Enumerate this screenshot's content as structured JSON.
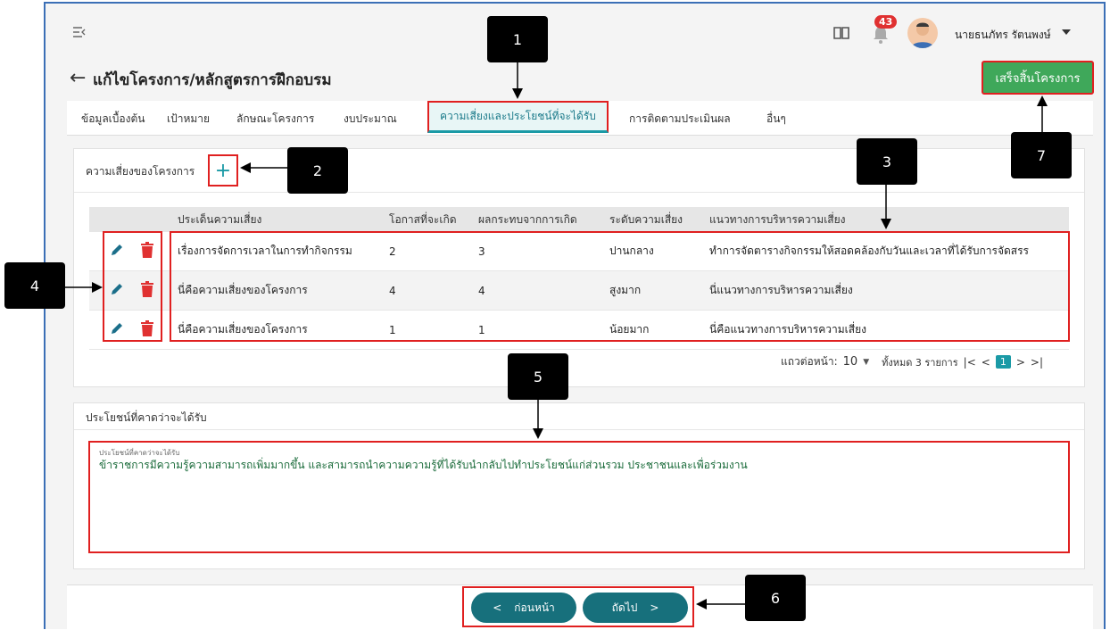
{
  "header": {
    "notification_count": "43",
    "username": "นายธนภัทร รัตนพงษ์",
    "page_title": "แก้ไขโครงการ/หลักสูตรการฝึกอบรม",
    "finish_label": "เสร็จสิ้นโครงการ"
  },
  "tabs": [
    {
      "label": "ข้อมูลเบื้องต้น"
    },
    {
      "label": "เป้าหมาย"
    },
    {
      "label": "ลักษณะโครงการ"
    },
    {
      "label": "งบประมาณ"
    },
    {
      "label": "ความเสี่ยงและประโยชน์ที่จะได้รับ"
    },
    {
      "label": "การติดตามประเมินผล"
    },
    {
      "label": "อื่นๆ"
    }
  ],
  "risk_section": {
    "title": "ความเสี่ยงของโครงการ",
    "columns": [
      "ประเด็นความเสี่ยง",
      "โอกาสที่จะเกิด",
      "ผลกระทบจากการเกิด",
      "ระดับความเสี่ยง",
      "แนวทางการบริหารความเสี่ยง"
    ],
    "rows": [
      {
        "issue": "เรื่องการจัดการเวลาในการทำกิจกรรม",
        "likelihood": "2",
        "impact": "3",
        "level": "ปานกลาง",
        "approach": "ทำการจัดตารางกิจกรรมให้สอดคล้องกับวันและเวลาที่ได้รับการจัดสรร"
      },
      {
        "issue": "นี่คือความเสี่ยงของโครงการ",
        "likelihood": "4",
        "impact": "4",
        "level": "สูงมาก",
        "approach": "นี่แนวทางการบริหารความเสี่ยง"
      },
      {
        "issue": "นี่คือความเสี่ยงของโครงการ",
        "likelihood": "1",
        "impact": "1",
        "level": "น้อยมาก",
        "approach": "นี่คือแนวทางการบริหารความเสี่ยง"
      }
    ],
    "pager": {
      "rows_per_page_label": "แถวต่อหน้า:",
      "rows_per_page": "10",
      "total_label": "ทั้งหมด 3 รายการ",
      "current_page": "1"
    }
  },
  "benefit_section": {
    "title": "ประโยชน์ที่คาดว่าจะได้รับ",
    "field_label": "ประโยชน์ที่คาดว่าจะได้รับ",
    "value": "ข้าราชการมีความรู้ความสามารถเพิ่มมากขึ้น และสามารถนำความความรู้ที่ได้รับนำกลับไปทำประโยชน์แก่ส่วนรวม ประชาชนและเพื่อร่วมงาน"
  },
  "nav": {
    "prev_label": "ก่อนหน้า",
    "next_label": "ถัดไป"
  },
  "callouts": [
    "1",
    "2",
    "3",
    "4",
    "5",
    "6",
    "7"
  ],
  "colors": {
    "accent": "#1b9aa6",
    "finish_green": "#3fa85a",
    "highlight_red": "#e02020",
    "edit_blue": "#1b6f8a",
    "delete_red": "#e03131"
  }
}
